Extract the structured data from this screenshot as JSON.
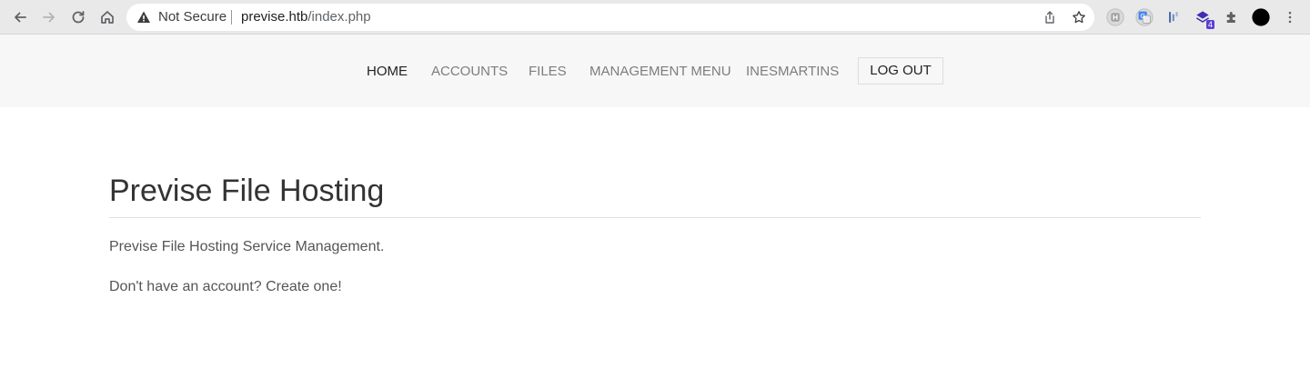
{
  "browser": {
    "security_label": "Not Secure",
    "url_host": "previse.htb",
    "url_path": "/index.php",
    "extension_badge_count": "4"
  },
  "nav": {
    "links": [
      {
        "label": "HOME",
        "active": true
      },
      {
        "label": "ACCOUNTS",
        "active": false
      },
      {
        "label": "FILES",
        "active": false
      },
      {
        "label": "MANAGEMENT MENU",
        "active": false
      },
      {
        "label": "INESMARTINS",
        "active": false
      }
    ],
    "logout_label": "LOG OUT"
  },
  "content": {
    "title": "Previse File Hosting",
    "paragraphs": [
      "Previse File Hosting Service Management.",
      "Don't have an account? Create one!"
    ]
  },
  "colors": {
    "chrome_bg": "#e9e9e9",
    "navbar_bg": "#f7f7f7",
    "active_link": "#222222",
    "inactive_link": "#7d7d7d"
  }
}
